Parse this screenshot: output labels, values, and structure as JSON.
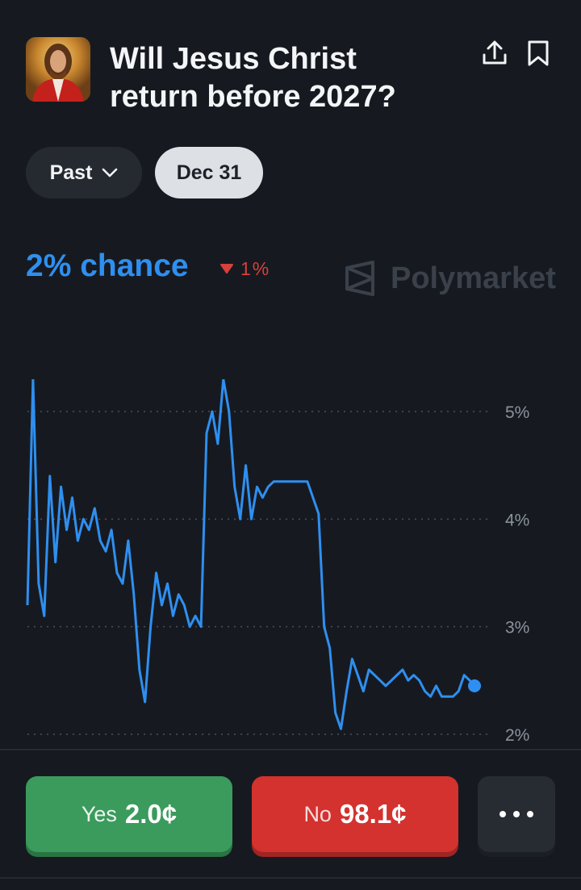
{
  "market": {
    "title_line1": "Will Jesus Christ",
    "title_line2": "return before 2027?",
    "icons": {
      "share": "share-upload-icon",
      "bookmark": "bookmark-icon",
      "chevron": "chevron-down-icon",
      "thumbnail": "market-thumbnail-image"
    }
  },
  "filters": {
    "past_label": "Past",
    "date_label": "Dec 31"
  },
  "stats": {
    "chance_text": "2% chance",
    "delta_text": "1%",
    "delta_direction": "down",
    "watermark": "Polymarket"
  },
  "chart_data": {
    "type": "line",
    "title": "",
    "xlabel": "",
    "ylabel": "",
    "yticks": [
      "5%",
      "4%",
      "3%",
      "2%"
    ],
    "ylim": [
      2,
      5
    ],
    "grid": true,
    "color": "#2f8ff0",
    "series": [
      {
        "values": [
          3.2,
          5.3,
          3.4,
          3.1,
          4.4,
          3.6,
          4.3,
          3.9,
          4.2,
          3.8,
          4.0,
          3.9,
          4.1,
          3.8,
          3.7,
          3.9,
          3.5,
          3.4,
          3.8,
          3.3,
          2.6,
          2.3,
          3.0,
          3.5,
          3.2,
          3.4,
          3.1,
          3.3,
          3.2,
          3.0,
          3.1,
          3.0,
          4.8,
          5.0,
          4.7,
          5.3,
          5.0,
          4.3,
          4.0,
          4.5,
          4.0,
          4.3,
          4.2,
          4.3,
          4.35,
          4.35,
          4.35,
          4.35,
          4.35,
          4.35,
          4.35,
          4.2,
          4.05,
          3.0,
          2.8,
          2.2,
          2.05,
          2.4,
          2.7,
          2.55,
          2.4,
          2.6,
          2.55,
          2.5,
          2.45,
          2.5,
          2.55,
          2.6,
          2.5,
          2.55,
          2.5,
          2.4,
          2.35,
          2.45,
          2.35,
          2.35,
          2.35,
          2.4,
          2.55,
          2.5,
          2.45,
          2.45
        ]
      }
    ]
  },
  "actions": {
    "yes_label": "Yes",
    "yes_price": "2.0¢",
    "no_label": "No",
    "no_price": "98.1¢"
  },
  "colors": {
    "background": "#161a20",
    "accent": "#2f8ff0",
    "yes": "#3a9b5c",
    "no": "#d3322f"
  }
}
